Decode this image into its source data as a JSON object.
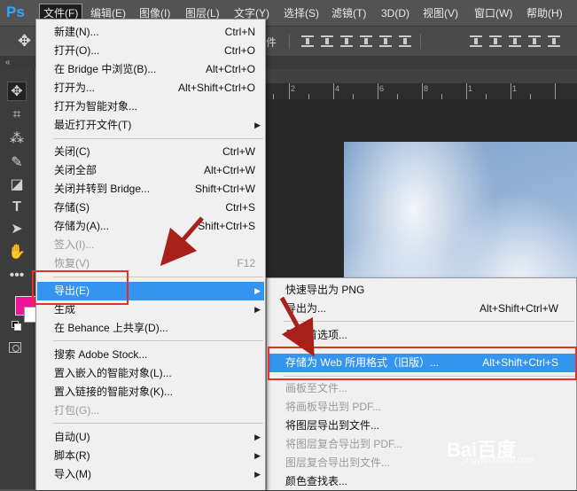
{
  "menubar": {
    "logo": "Ps",
    "items": [
      {
        "label": "文件(F)",
        "active": true
      },
      {
        "label": "编辑(E)"
      },
      {
        "label": "图像(I)"
      },
      {
        "label": "图层(L)"
      },
      {
        "label": "文字(Y)"
      },
      {
        "label": "选择(S)"
      },
      {
        "label": "滤镜(T)"
      },
      {
        "label": "3D(D)"
      },
      {
        "label": "视图(V)"
      },
      {
        "label": "窗口(W)"
      },
      {
        "label": "帮助(H)"
      }
    ]
  },
  "options_bar": {
    "partial_text": "件"
  },
  "strip": {
    "collapse_glyph": "«"
  },
  "ruler": {
    "labels": [
      "2",
      "4",
      "6",
      "8",
      "1",
      "1"
    ]
  },
  "colors": {
    "accent": "#3395f0",
    "highlight_box": "#e8302a",
    "foreground": "#f0149a",
    "background": "#ffffff"
  },
  "file_menu": {
    "items": [
      {
        "label": "新建(N)...",
        "shortcut": "Ctrl+N"
      },
      {
        "label": "打开(O)...",
        "shortcut": "Ctrl+O"
      },
      {
        "label": "在 Bridge 中浏览(B)...",
        "shortcut": "Alt+Ctrl+O"
      },
      {
        "label": "打开为...",
        "shortcut": "Alt+Shift+Ctrl+O"
      },
      {
        "label": "打开为智能对象...",
        "shortcut": ""
      },
      {
        "label": "最近打开文件(T)",
        "shortcut": "",
        "submenu": true
      },
      {
        "label": "关闭(C)",
        "shortcut": "Ctrl+W"
      },
      {
        "label": "关闭全部",
        "shortcut": "Alt+Ctrl+W"
      },
      {
        "label": "关闭并转到 Bridge...",
        "shortcut": "Shift+Ctrl+W"
      },
      {
        "label": "存储(S)",
        "shortcut": "Ctrl+S"
      },
      {
        "label": "存储为(A)...",
        "shortcut": "Shift+Ctrl+S"
      },
      {
        "label": "签入(I)...",
        "shortcut": "",
        "disabled": true
      },
      {
        "label": "恢复(V)",
        "shortcut": "F12",
        "disabled": true
      },
      {
        "label": "导出(E)",
        "shortcut": "",
        "submenu": true,
        "highlighted": true
      },
      {
        "label": "生成",
        "shortcut": "",
        "submenu": true
      },
      {
        "label": "在 Behance 上共享(D)...",
        "shortcut": ""
      },
      {
        "label": "搜索 Adobe Stock...",
        "shortcut": ""
      },
      {
        "label": "置入嵌入的智能对象(L)...",
        "shortcut": ""
      },
      {
        "label": "置入链接的智能对象(K)...",
        "shortcut": ""
      },
      {
        "label": "打包(G)...",
        "shortcut": "",
        "disabled": true
      },
      {
        "label": "自动(U)",
        "shortcut": "",
        "submenu": true
      },
      {
        "label": "脚本(R)",
        "shortcut": "",
        "submenu": true
      },
      {
        "label": "导入(M)",
        "shortcut": "",
        "submenu": true
      }
    ]
  },
  "export_menu": {
    "items": [
      {
        "label": "快速导出为 PNG",
        "shortcut": ""
      },
      {
        "label": "导出为...",
        "shortcut": "Alt+Shift+Ctrl+W"
      },
      {
        "label": "导出首选项...",
        "shortcut": ""
      },
      {
        "label": "存储为 Web 所用格式（旧版）...",
        "shortcut": "Alt+Shift+Ctrl+S",
        "highlighted": true
      },
      {
        "label": "画板至文件...",
        "shortcut": "",
        "disabled": true
      },
      {
        "label": "将画板导出到 PDF...",
        "shortcut": "",
        "disabled": true
      },
      {
        "label": "将图层导出到文件...",
        "shortcut": ""
      },
      {
        "label": "将图层复合导出到 PDF...",
        "shortcut": "",
        "disabled": true
      },
      {
        "label": "图层复合导出到文件...",
        "shortcut": "",
        "disabled": true
      },
      {
        "label": "颜色查找表...",
        "shortcut": ""
      }
    ]
  },
  "watermark": {
    "text": "Bai百度",
    "sub": "jingyan.baidu.com"
  }
}
